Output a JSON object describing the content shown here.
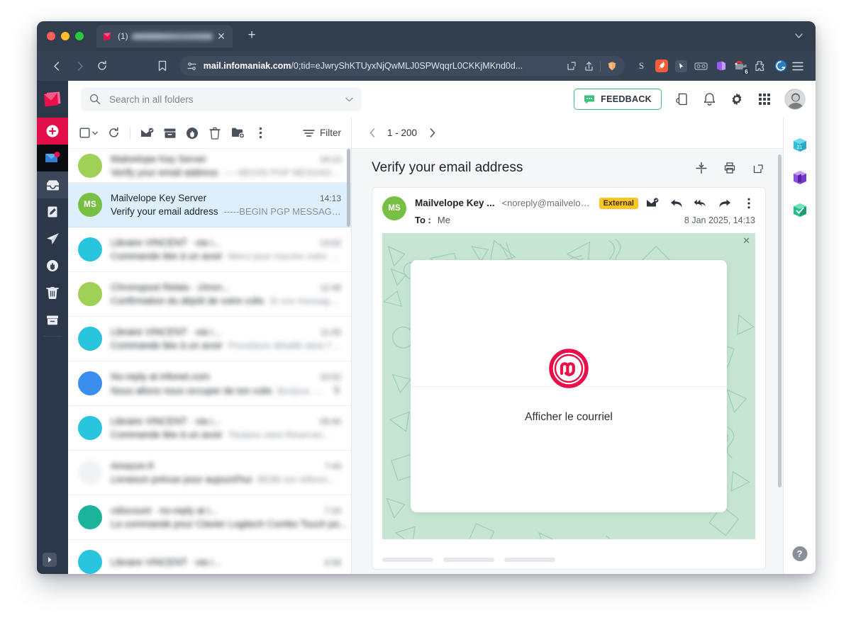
{
  "browser": {
    "tab": {
      "favicon": "infomaniak-logo-icon",
      "unread_count": "(1)",
      "title_redacted": "",
      "close_label": "✕"
    },
    "new_tab_label": "+",
    "tab_menu_label": "⌄",
    "nav": {
      "back": "‹",
      "forward": "›",
      "reload": "⟳",
      "bookmark": "bookmark-icon"
    },
    "omnibox": {
      "site_settings_icon": "permissions-icon",
      "url_host": "mail.infomaniak.com",
      "url_path": "/0;tid=eJwryShKTUyxNjQwMLJ0SPWqqrL0CKKjMKnd0d...",
      "popout_icon": "open-in-new-icon",
      "share_icon": "share-icon",
      "brave_icon": "brave-shield-icon"
    },
    "extensions": [
      {
        "name": "simplify-extension",
        "glyph": "S"
      },
      {
        "name": "rocket-extension",
        "glyph": "➤"
      },
      {
        "name": "cursor-extension",
        "glyph": "↖"
      },
      {
        "name": "glasses-extension",
        "glyph": "○○"
      },
      {
        "name": "purple-book-extension",
        "glyph": ""
      },
      {
        "name": "santa-video-extension",
        "glyph": "",
        "badge": "6"
      },
      {
        "name": "puzzle-extension",
        "glyph": ""
      },
      {
        "name": "grammarly-extension",
        "glyph": "G"
      }
    ],
    "menu_icon": "hamburger-menu-icon"
  },
  "left_rail": {
    "logo": "infomaniak-mail-logo",
    "compose_label": "+",
    "items": [
      {
        "name": "mail-app",
        "icon": "mail-icon",
        "active": true
      },
      {
        "name": "inbox",
        "icon": "inbox-icon",
        "active": true
      },
      {
        "name": "drafts",
        "icon": "draft-pencil-icon"
      },
      {
        "name": "sent",
        "icon": "paper-plane-icon"
      },
      {
        "name": "spam",
        "icon": "spam-hand-icon"
      },
      {
        "name": "trash",
        "icon": "trash-icon"
      },
      {
        "name": "archive",
        "icon": "archive-icon"
      }
    ],
    "collapse_label": "▶"
  },
  "header": {
    "search": {
      "placeholder": "Search in all folders",
      "icon": "search-icon",
      "dropdown_icon": "chevron-down-icon"
    },
    "feedback_label": "FEEDBACK",
    "feedback_icon": "chat-bubble-icon",
    "feedback_border_color": "#3ac17a",
    "icons": [
      {
        "name": "news-feed-icon"
      },
      {
        "name": "notifications-bell-icon"
      },
      {
        "name": "settings-gear-icon"
      },
      {
        "name": "app-grid-icon"
      }
    ],
    "avatar": "user-avatar"
  },
  "list_toolbar": {
    "select_all_icon": "checkbox-icon",
    "select_all_caret": "chevron-down-icon",
    "refresh_icon": "refresh-icon",
    "mark_read_icon": "mark-as-read-icon",
    "archive_icon": "archive-icon",
    "spam_icon": "report-spam-icon",
    "delete_icon": "trash-icon",
    "move_icon": "move-to-folder-icon",
    "more_icon": "more-vertical-icon",
    "filter_label": "Filter",
    "filter_icon": "filter-lines-icon"
  },
  "pagination": {
    "prev_icon": "chevron-left-icon",
    "range": "1 - 200",
    "next_icon": "chevron-right-icon"
  },
  "mail_list": [
    {
      "avatar_initials": "",
      "avatar_color": "#9ed156",
      "sender": "Mailvelope Key Server",
      "time": "14:13",
      "subject": "Verify your email address",
      "preview": "-----BEGIN PGP MESSAGE-...",
      "selected": false,
      "redacted": true,
      "partial": true
    },
    {
      "avatar_initials": "MS",
      "avatar_color": "#77c043",
      "sender": "Mailvelope Key Server",
      "time": "14:13",
      "subject": "Verify your email address",
      "preview": "-----BEGIN PGP MESSAGE-...",
      "selected": true,
      "redacted": false
    },
    {
      "avatar_initials": "",
      "avatar_color": "#29c4de",
      "sender": "Libraire VINCENT · via i...",
      "time": "13:02",
      "subject": "Commande liée à un avoir",
      "preview": "Merci pour inscrire votre n...",
      "redacted": true
    },
    {
      "avatar_initials": "",
      "avatar_color": "#9ed156",
      "sender": "Chronopost Relais · chron...",
      "time": "12:46",
      "subject": "Confirmation du dépôt de votre colis",
      "preview": "Si vos messages...",
      "redacted": true
    },
    {
      "avatar_initials": "",
      "avatar_color": "#29c4de",
      "sender": "Libraire VINCENT · via i...",
      "time": "11:05",
      "subject": "Commande liée à un avoir",
      "preview": "Procédure détaillé dans l'e...",
      "redacted": true
    },
    {
      "avatar_initials": "",
      "avatar_color": "#3a8ef0",
      "sender": "No-reply at infonet.com",
      "time": "10:52",
      "subject": "Nous allons nous occuper de ton colis",
      "preview": "Bonjour, Vo...",
      "redacted": true,
      "has_attachment": true
    },
    {
      "avatar_initials": "",
      "avatar_color": "#29c4de",
      "sender": "Libraire VINCENT · via i...",
      "time": "09:40",
      "subject": "Commande liée à un avoir",
      "preview": "Titulaire vient Réserver...",
      "redacted": true
    },
    {
      "avatar_initials": "",
      "avatar_color": "#ffffff",
      "sender": "Amazon.fr",
      "time": "7:44",
      "subject": "Livraison prévue pour aujourd'hui",
      "preview": "BEIBI est référencé s...",
      "redacted": true
    },
    {
      "avatar_initials": "",
      "avatar_color": "#1bb49b",
      "sender": "cdiscount · no-reply at i...",
      "time": "7:20",
      "subject": "La commande pour Clavier Logitech Combo Touch po...",
      "preview": "",
      "redacted": true
    },
    {
      "avatar_initials": "",
      "avatar_color": "#29c4de",
      "sender": "Libraire VINCENT · via i...",
      "time": "6:58",
      "subject": "",
      "preview": "",
      "redacted": true,
      "partial": true
    }
  ],
  "reading": {
    "subject": "Verify your email address",
    "actions": [
      {
        "name": "unsubscribe-icon"
      },
      {
        "name": "print-icon"
      },
      {
        "name": "open-in-new-window-icon"
      }
    ],
    "message": {
      "avatar_initials": "MS",
      "avatar_color": "#77c043",
      "from_name": "Mailvelope Key ...",
      "from_email": "<noreply@mailvelope...",
      "badge": "External",
      "badge_color": "#fcc425",
      "to_label": "To :",
      "to_value": "Me",
      "date": "8 Jan 2025, 14:13",
      "actions": [
        {
          "name": "mark-unread-icon"
        },
        {
          "name": "reply-icon"
        },
        {
          "name": "reply-all-icon"
        },
        {
          "name": "forward-icon"
        },
        {
          "name": "more-vertical-icon"
        }
      ]
    },
    "mailvelope": {
      "close_label": "✕",
      "logo": "mailvelope-logo",
      "logo_color": "#e8104a",
      "cta_text": "Afficher le courriel",
      "background_color": "#c6e6d3"
    }
  },
  "right_rail": {
    "apps": [
      {
        "name": "calendar-app-icon",
        "label": "21",
        "color": "#2fc0e0"
      },
      {
        "name": "contacts-app-icon",
        "label": "",
        "color": "#8e4ee0"
      },
      {
        "name": "tasks-app-icon",
        "label": "✓",
        "color": "#1ec08a"
      }
    ],
    "help_label": "?"
  }
}
